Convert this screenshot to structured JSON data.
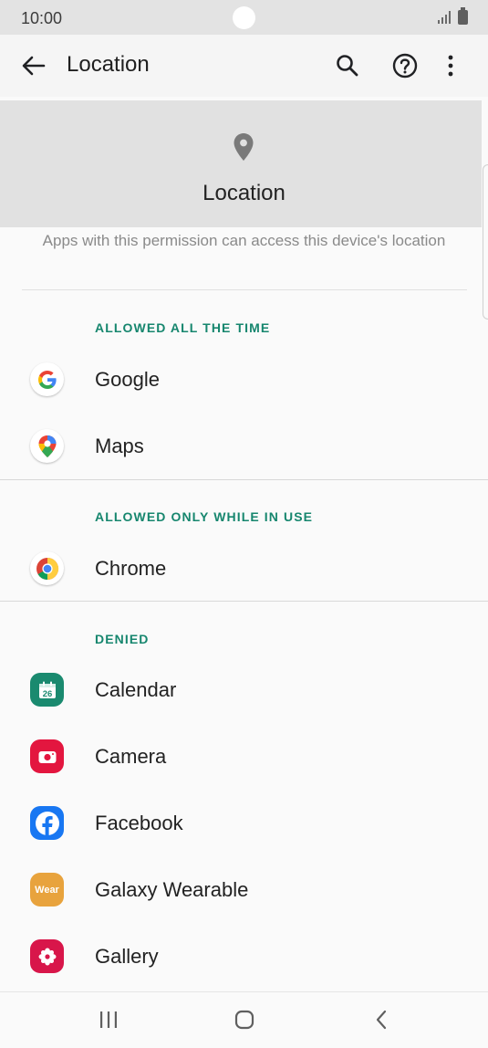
{
  "status_bar": {
    "time": "10:00",
    "icons": [
      "signal-icon",
      "battery-icon"
    ]
  },
  "app_bar": {
    "title": "Location",
    "icons": [
      "back-arrow-icon",
      "search-icon",
      "help-icon",
      "more-options-icon"
    ]
  },
  "header": {
    "icon": "location-pin-icon",
    "title": "Location",
    "description": "Apps with this permission can access this device's location"
  },
  "sections": [
    {
      "title": "ALLOWED ALL THE TIME",
      "apps": [
        {
          "label": "Google",
          "icon": "google-icon"
        },
        {
          "label": "Maps",
          "icon": "maps-icon"
        }
      ]
    },
    {
      "title": "ALLOWED ONLY WHILE IN USE",
      "apps": [
        {
          "label": "Chrome",
          "icon": "chrome-icon"
        }
      ]
    },
    {
      "title": "DENIED",
      "apps": [
        {
          "label": "Calendar",
          "icon": "calendar-icon",
          "icon_text": "26"
        },
        {
          "label": "Camera",
          "icon": "camera-icon"
        },
        {
          "label": "Facebook",
          "icon": "facebook-icon"
        },
        {
          "label": "Galaxy Wearable",
          "icon": "wear-icon",
          "icon_text": "Wear"
        },
        {
          "label": "Gallery",
          "icon": "gallery-icon"
        }
      ]
    }
  ],
  "nav_bar": {
    "icons": [
      "recent-apps-icon",
      "home-icon",
      "back-icon"
    ]
  },
  "colors": {
    "accent": "#16866e",
    "header_bg": "#e1e1e1",
    "background": "#fafafa"
  }
}
